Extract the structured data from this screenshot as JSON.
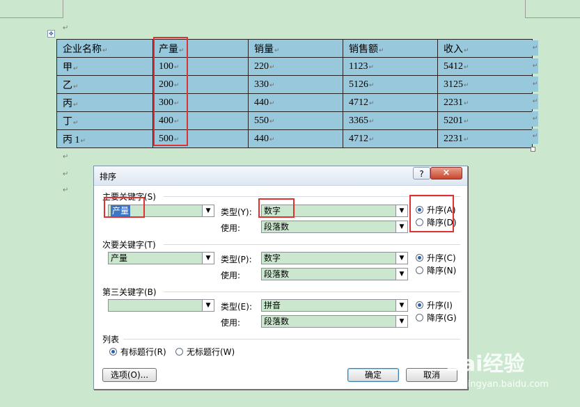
{
  "table": {
    "headers": [
      "企业名称",
      "产量",
      "销量",
      "销售额",
      "收入"
    ],
    "rows": [
      [
        "甲",
        "100",
        "220",
        "1123",
        "5412"
      ],
      [
        "乙",
        "200",
        "330",
        "5126",
        "3125"
      ],
      [
        "丙",
        "300",
        "440",
        "4712",
        "2231"
      ],
      [
        "丁",
        "400",
        "550",
        "3365",
        "5201"
      ],
      [
        "丙 1",
        "500",
        "440",
        "4712",
        "2231"
      ]
    ]
  },
  "dialog": {
    "title": "排序",
    "help": "?",
    "close": "×",
    "primary": {
      "label": "主要关键字(S)",
      "key": "产量",
      "type_label": "类型(Y):",
      "type": "数字",
      "use_label": "使用:",
      "use": "段落数",
      "asc": "升序(A)",
      "desc": "降序(D)"
    },
    "secondary": {
      "label": "次要关键字(T)",
      "key": "产量",
      "type_label": "类型(P):",
      "type": "数字",
      "use_label": "使用:",
      "use": "段落数",
      "asc": "升序(C)",
      "desc": "降序(N)"
    },
    "third": {
      "label": "第三关键字(B)",
      "key": "",
      "type_label": "类型(E):",
      "type": "拼音",
      "use_label": "使用:",
      "use": "段落数",
      "asc": "升序(I)",
      "desc": "降序(G)"
    },
    "list": {
      "label": "列表",
      "header_row": "有标题行(R)",
      "no_header_row": "无标题行(W)"
    },
    "options_button": "选项(O)...",
    "ok_button": "确定",
    "cancel_button": "取消"
  },
  "watermark": {
    "brand": "Bai经验",
    "url": "jingyan.baidu.com"
  },
  "colors": {
    "background": "#cbe8cf",
    "table_fill": "#98c8dc",
    "highlight": "#e03030"
  }
}
